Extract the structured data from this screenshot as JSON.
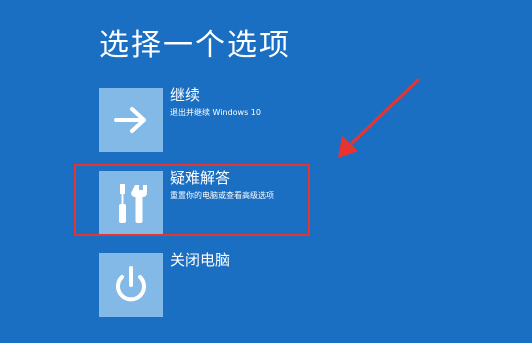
{
  "screen": {
    "title": "选择一个选项"
  },
  "options": [
    {
      "label": "继续",
      "description": "退出并继续 Windows 10",
      "icon": "arrow-right-icon"
    },
    {
      "label": "疑难解答",
      "description": "重置你的电脑或查看高级选项",
      "icon": "tools-icon"
    },
    {
      "label": "关闭电脑",
      "description": "",
      "icon": "power-icon"
    }
  ],
  "colors": {
    "background": "#1b6fc2",
    "tile": "#83b9e6",
    "annotation": "#e8342f"
  }
}
